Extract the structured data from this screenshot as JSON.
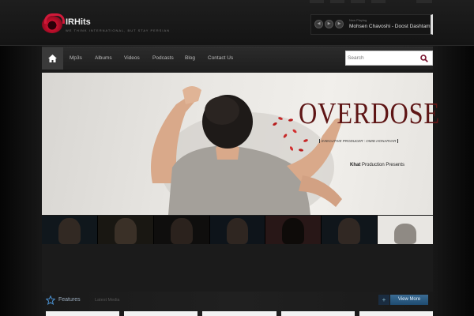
{
  "header": {
    "logo_name": "IRHits",
    "logo_tagline": "WE THINK INTERNATIONAL, BUT STAY PERSIAN",
    "now_playing": {
      "label": "Now Playing",
      "track": "Mohsen Chavoshi - Doost Dashtam"
    }
  },
  "nav": {
    "items": [
      "Mp3s",
      "Albums",
      "Videos",
      "Podcasts",
      "Blog",
      "Contact Us"
    ],
    "search_placeholder": "Search"
  },
  "hero": {
    "presents_brand": "Khat",
    "presents_rest": " Production Presents",
    "title": "OVERDOSE",
    "producer": "EXECUTIVE PRODUCER : OMID HONARVAR"
  },
  "thumbnails": {
    "count": 7,
    "active_index": 6
  },
  "features": {
    "title": "Features",
    "subtitle": "Latest Media",
    "plus_label": "+",
    "view_more": "View More"
  },
  "colors": {
    "accent_red": "#c8102e",
    "title_maroon": "#5e1515",
    "button_blue": "#2e5f88"
  }
}
